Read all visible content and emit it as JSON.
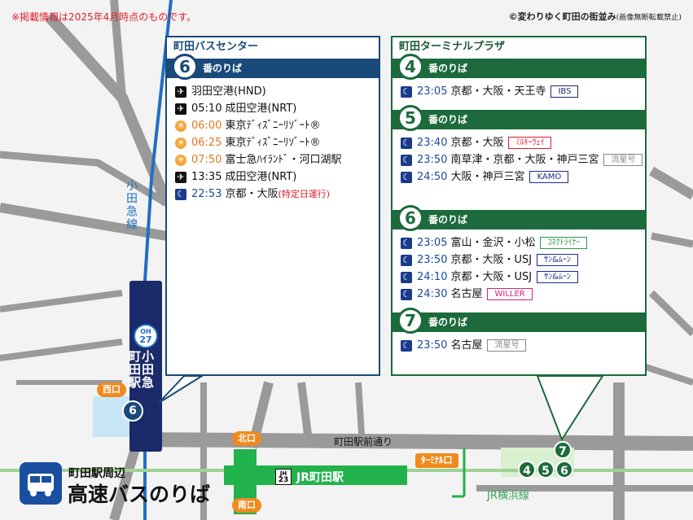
{
  "notice": "※掲載情報は2025年4月時点のものです。",
  "credit": {
    "main": "©変わりゆく町田の街並み",
    "sub": "(画像無断転載禁止)"
  },
  "left_panel": {
    "title": "町田バスセンター",
    "bay": {
      "number": "6",
      "label": "番のりば"
    },
    "rows": [
      {
        "icon": "plane-icon",
        "time": "",
        "time_style": "",
        "dest": "羽田空港(HND)",
        "note": ""
      },
      {
        "icon": "plane-icon",
        "time": "05:10",
        "time_style": "plain",
        "dest": "成田空港(NRT)",
        "note": ""
      },
      {
        "icon": "sun-icon",
        "time": "06:00",
        "time_style": "day",
        "dest": "東京ﾃﾞｨｽﾞﾆｰﾘｿﾞｰﾄ®",
        "note": ""
      },
      {
        "icon": "sun-icon",
        "time": "06:25",
        "time_style": "day",
        "dest": "東京ﾃﾞｨｽﾞﾆｰﾘｿﾞｰﾄ®",
        "note": ""
      },
      {
        "icon": "sun-icon",
        "time": "07:50",
        "time_style": "day",
        "dest": "富士急ﾊｲﾗﾝﾄﾞ・河口湖駅",
        "note": ""
      },
      {
        "icon": "plane-icon",
        "time": "13:35",
        "time_style": "plain",
        "dest": "成田空港(NRT)",
        "note": ""
      },
      {
        "icon": "moon-icon",
        "time": "22:53",
        "time_style": "night",
        "dest": "京都・大阪",
        "note": "(特定日運行)"
      }
    ]
  },
  "right_panel": {
    "title": "町田ターミナルプラザ",
    "bays": [
      {
        "number": "4",
        "label": "番のりば",
        "rows": [
          {
            "time": "23:05",
            "dest": "京都・大阪・天王寺",
            "tag": "IBS",
            "tag_color": "#1a2a6a"
          }
        ]
      },
      {
        "number": "5",
        "label": "番のりば",
        "rows": [
          {
            "time": "23:40",
            "dest": "京都・大阪",
            "tag": "ﾐﾙｷｰｳｪｲ",
            "tag_color": "#d8202c"
          },
          {
            "time": "23:50",
            "dest": "南草津・京都・大阪・神戸三宮",
            "tag": "流星号",
            "tag_color": "#888888"
          },
          {
            "time": "24:50",
            "dest": "大阪・神戸三宮",
            "tag": "KAMO",
            "tag_color": "#1a2a8a"
          }
        ]
      },
      {
        "number": "6",
        "label": "番のりば",
        "rows": [
          {
            "time": "23:05",
            "dest": "富山・金沢・小松",
            "tag": "ｺﾈｸﾄﾗｲﾅｰ",
            "tag_color": "#2a9a4a"
          },
          {
            "time": "23:50",
            "dest": "京都・大阪・USJ",
            "tag": "ｻﾝ&ﾑｰﾝ",
            "tag_color": "#1a2a9a"
          },
          {
            "time": "24:10",
            "dest": "京都・大阪・USJ",
            "tag": "ｻﾝ&ﾑｰﾝ",
            "tag_color": "#1a2a9a"
          },
          {
            "time": "24:30",
            "dest": "名古屋",
            "tag": "WILLER",
            "tag_color": "#d8207a"
          }
        ]
      },
      {
        "number": "7",
        "label": "番のりば",
        "rows": [
          {
            "time": "23:50",
            "dest": "名古屋",
            "tag": "流星号",
            "tag_color": "#888888"
          }
        ]
      }
    ]
  },
  "map": {
    "odakyu_line": "小田急線",
    "odakyu_station": {
      "line1": "小田急",
      "line2": "町田駅",
      "code_line": "OH",
      "code_num": "27"
    },
    "west_exit": "西口",
    "north_exit": "北口",
    "south_exit": "南口",
    "terminal_exit": "ﾀｰﾐﾅﾙ口",
    "road": "町田駅前通り",
    "jr_station": "JR町田駅",
    "jr_code_line": "JH",
    "jr_code_num": "23",
    "jr_line": "JR横浜線",
    "bus_stop_left": "6",
    "bus_stop_right": [
      "7",
      "4",
      "5",
      "6"
    ]
  },
  "legend": {
    "line1": "町田駅周辺",
    "line2": "高速バスのりば"
  },
  "colors": {
    "odakyu_blue": "#1a3a78",
    "jr_green": "#22b24c",
    "panel_blue": "#1a4a7a",
    "panel_green": "#1d6b3c",
    "exit_orange": "#f08a1e"
  }
}
